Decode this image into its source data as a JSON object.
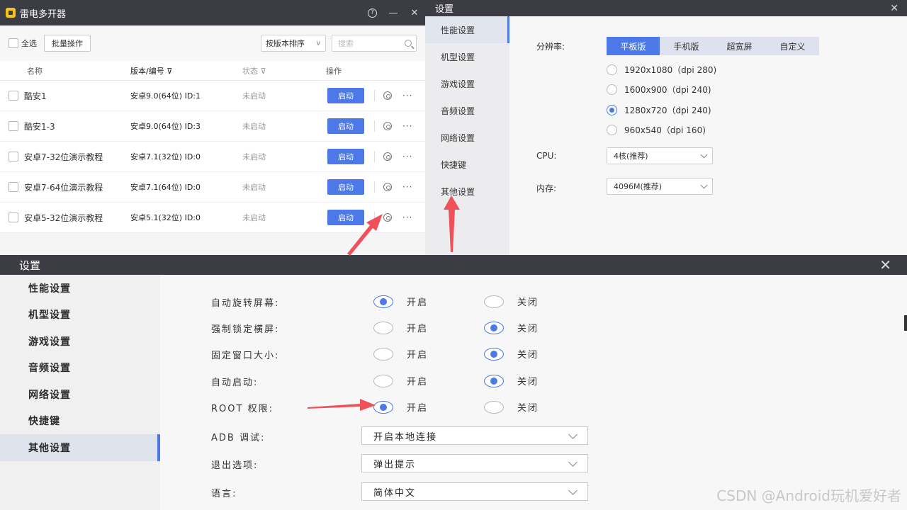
{
  "manager": {
    "title": "雷电多开器",
    "help_icon": "?",
    "select_all": "全选",
    "batch_button": "批量操作",
    "sort": {
      "selected": "按版本排序"
    },
    "search": {
      "placeholder": "搜索"
    },
    "columns": {
      "name": "名称",
      "version": "版本/编号",
      "state": "状态",
      "action": "操作"
    },
    "start_label": "启动",
    "more_label": "···",
    "rows": [
      {
        "name": "酷安1",
        "version": "安卓9.0(64位)   ID:1",
        "state": "未启动"
      },
      {
        "name": "酷安1-3",
        "version": "安卓9.0(64位)   ID:3",
        "state": "未启动"
      },
      {
        "name": "安卓7-32位演示教程",
        "version": "安卓7.1(32位)   ID:0",
        "state": "未启动"
      },
      {
        "name": "安卓7-64位演示教程",
        "version": "安卓7.1(64位)   ID:0",
        "state": "未启动"
      },
      {
        "name": "安卓5-32位演示教程",
        "version": "安卓5.1(32位)   ID:0",
        "state": "未启动"
      }
    ]
  },
  "settings_top": {
    "title": "设置",
    "close": "✕",
    "sidebar": [
      "性能设置",
      "机型设置",
      "游戏设置",
      "音频设置",
      "网络设置",
      "快捷键",
      "其他设置"
    ],
    "active_sidebar": "性能设置",
    "resolution": {
      "label": "分辨率:",
      "tabs": [
        "平板版",
        "手机版",
        "超宽屏",
        "自定义"
      ],
      "active_tab": "平板版",
      "options": [
        "1920x1080（dpi 280)",
        "1600x900（dpi 240)",
        "1280x720（dpi 240)",
        "960x540（dpi 160)"
      ],
      "selected": "1280x720（dpi 240)"
    },
    "cpu": {
      "label": "CPU:",
      "value": "4核(推荐)"
    },
    "memory": {
      "label": "内存:",
      "value": "4096M(推荐)"
    }
  },
  "settings_bottom": {
    "title": "设置",
    "close": "✕",
    "sidebar": [
      "性能设置",
      "机型设置",
      "游戏设置",
      "音频设置",
      "网络设置",
      "快捷键",
      "其他设置"
    ],
    "active_sidebar": "其他设置",
    "on_label": "开启",
    "off_label": "关闭",
    "toggles": [
      {
        "label": "自动旋转屏幕:",
        "value": "on"
      },
      {
        "label": "强制锁定横屏:",
        "value": "off"
      },
      {
        "label": "固定窗口大小:",
        "value": "off"
      },
      {
        "label": "自动启动:",
        "value": "off"
      },
      {
        "label": "ROOT 权限:",
        "value": "on"
      }
    ],
    "selects": [
      {
        "label": "ADB 调试:",
        "value": "开启本地连接"
      },
      {
        "label": "退出选项:",
        "value": "弹出提示"
      },
      {
        "label": "语言:",
        "value": "简体中文"
      }
    ]
  },
  "colors": {
    "accent": "#4c78e8",
    "titlebar": "#3b3c44",
    "annotation": "#f0505a"
  },
  "watermark": "CSDN @Android玩机爱好者"
}
